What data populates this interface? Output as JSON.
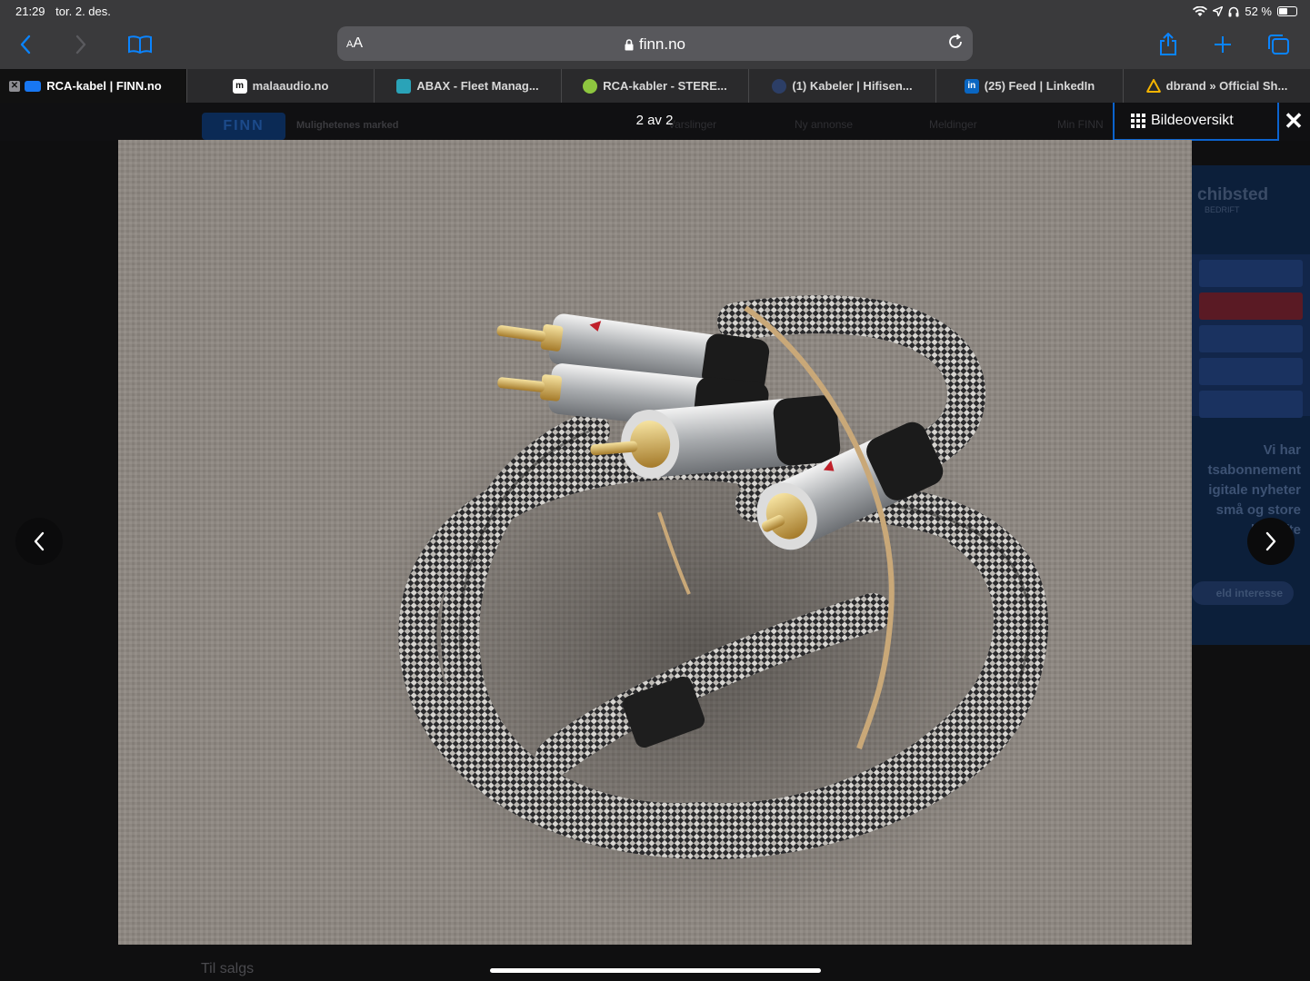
{
  "status": {
    "time": "21:29",
    "date": "tor. 2. des.",
    "battery": "52 %",
    "battery_level": 0.52
  },
  "toolbar": {
    "aa_label_small": "A",
    "aa_label_big": "A",
    "url": "finn.no"
  },
  "tabs": [
    {
      "label": "RCA-kabel | FINN.no",
      "active": true,
      "favicon": "finn-icon"
    },
    {
      "label": "malaaudio.no",
      "active": false,
      "favicon": "mala-icon"
    },
    {
      "label": "ABAX - Fleet Manag...",
      "active": false,
      "favicon": "abax-icon"
    },
    {
      "label": "RCA-kabler - STERE...",
      "active": false,
      "favicon": "stereo-icon"
    },
    {
      "label": "(1) Kabeler | Hifisen...",
      "active": false,
      "favicon": "hifisenteret-icon"
    },
    {
      "label": "(25) Feed | LinkedIn",
      "active": false,
      "favicon": "linkedin-icon"
    },
    {
      "label": "dbrand » Official Sh...",
      "active": false,
      "favicon": "dbrand-icon"
    }
  ],
  "favicon_text": {
    "mala": "m",
    "linkedin": "in"
  },
  "finn": {
    "logo": "FINN",
    "slogan": "Mulighetenes marked",
    "nav": [
      "Varslinger",
      "Ny annonse",
      "Meldinger",
      "Min FINN"
    ]
  },
  "gallery": {
    "counter": "2 av 2",
    "overview_label": "Bildeoversikt",
    "close": "✕",
    "prev": "‹",
    "next": "›",
    "photo_alt": "Braided RCA cable with gold-plated connectors coiled on grey fabric"
  },
  "sidead": {
    "brand": "chibsted",
    "sub": "BEDRIFT",
    "lines": [
      "Vi har",
      "tsabonnement",
      "igitale nyheter",
      "små og store",
      "bedrifte"
    ],
    "button": "eld interesse"
  },
  "below": {
    "section_label": "Til salgs"
  },
  "colors": {
    "accent": "#0a84ff",
    "finn_blue": "#0b63ce"
  }
}
